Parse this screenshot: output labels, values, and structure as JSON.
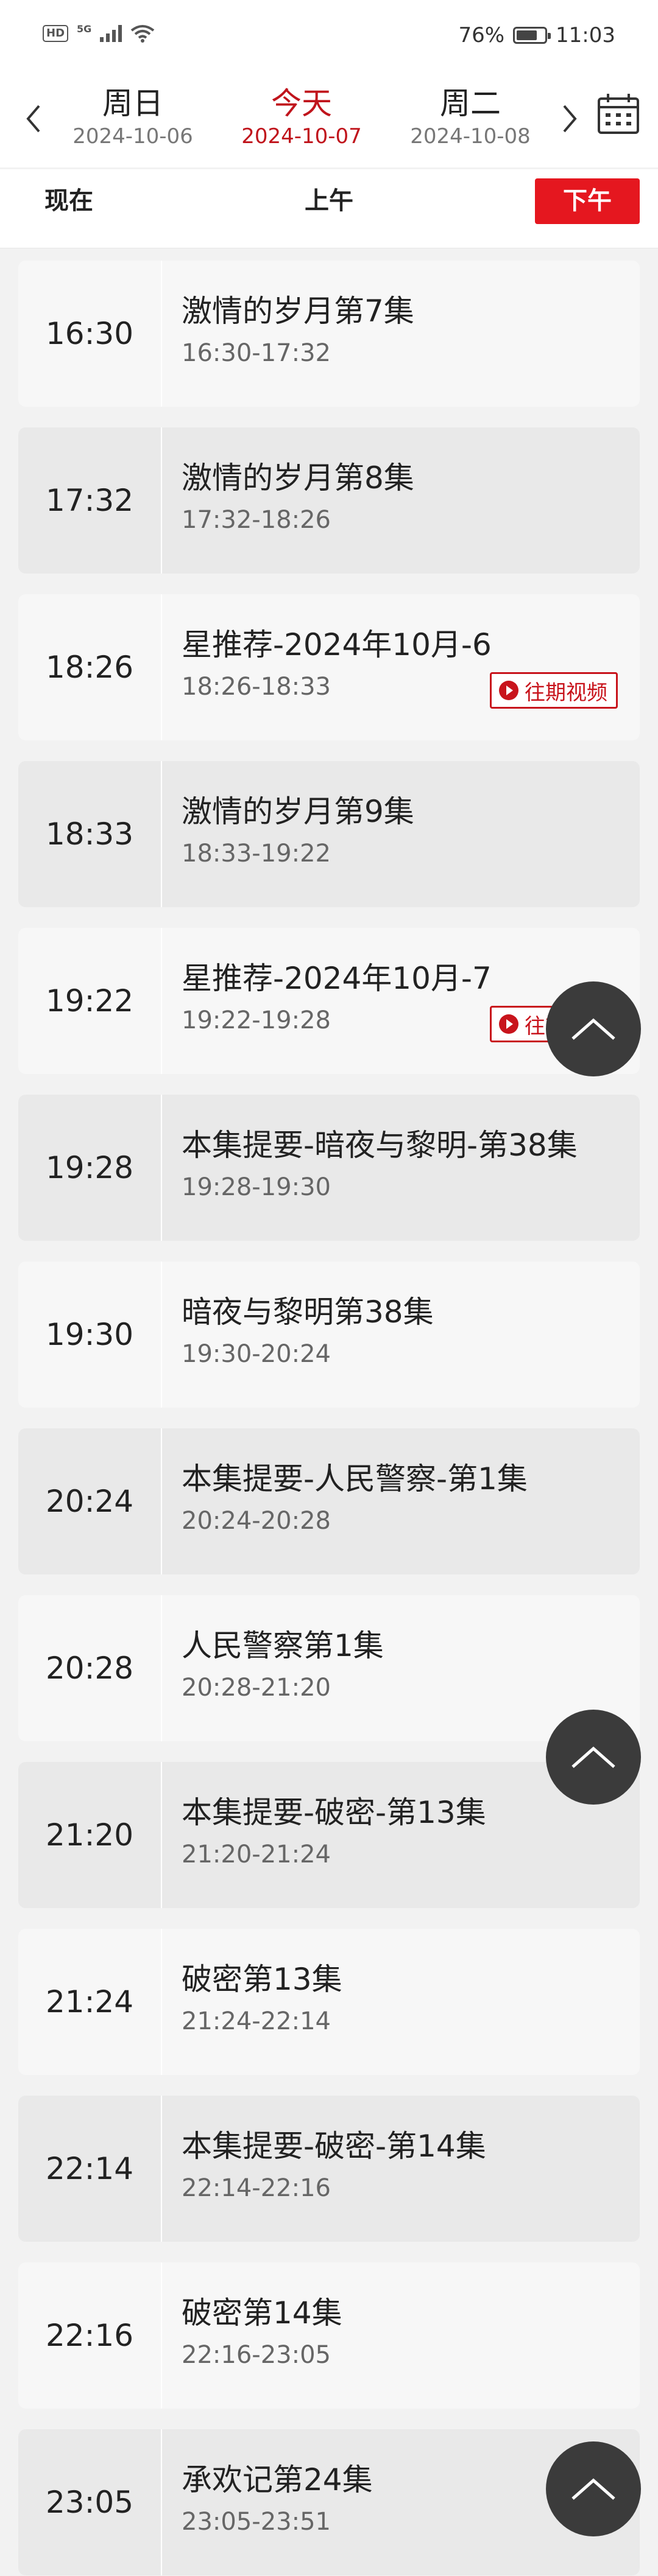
{
  "status_bar": {
    "hd": "HD",
    "network": "5G",
    "battery_percent_text": "76%",
    "battery_level": 0.76,
    "time": "11:03"
  },
  "date_nav": {
    "days": [
      {
        "name": "周日",
        "date": "2024-10-06",
        "active": false
      },
      {
        "name": "今天",
        "date": "2024-10-07",
        "active": true
      },
      {
        "name": "周二",
        "date": "2024-10-08",
        "active": false
      }
    ],
    "icons": {
      "prev": "chevron-left-icon",
      "next": "chevron-right-icon",
      "calendar": "calendar-icon"
    }
  },
  "period_tabs": {
    "now": "现在",
    "morning": "上午",
    "afternoon": "下午",
    "active": "afternoon"
  },
  "colors": {
    "accent": "#e5171f",
    "accent_text": "#c0141c"
  },
  "replay_label": "往期视频",
  "programs": [
    {
      "time": "16:30",
      "title": "激情的岁月第7集",
      "range": "16:30-17:32",
      "replay": false
    },
    {
      "time": "17:32",
      "title": "激情的岁月第8集",
      "range": "17:32-18:26",
      "replay": false
    },
    {
      "time": "18:26",
      "title": "星推荐-2024年10月-6",
      "range": "18:26-18:33",
      "replay": true
    },
    {
      "time": "18:33",
      "title": "激情的岁月第9集",
      "range": "18:33-19:22",
      "replay": false
    },
    {
      "time": "19:22",
      "title": "星推荐-2024年10月-7",
      "range": "19:22-19:28",
      "replay": true
    },
    {
      "time": "19:28",
      "title": "本集提要-暗夜与黎明-第38集",
      "range": "19:28-19:30",
      "replay": false
    },
    {
      "time": "19:30",
      "title": "暗夜与黎明第38集",
      "range": "19:30-20:24",
      "replay": false
    },
    {
      "time": "20:24",
      "title": "本集提要-人民警察-第1集",
      "range": "20:24-20:28",
      "replay": false
    },
    {
      "time": "20:28",
      "title": "人民警察第1集",
      "range": "20:28-21:20",
      "replay": false
    },
    {
      "time": "21:20",
      "title": "本集提要-破密-第13集",
      "range": "21:20-21:24",
      "replay": false
    },
    {
      "time": "21:24",
      "title": "破密第13集",
      "range": "21:24-22:14",
      "replay": false
    },
    {
      "time": "22:14",
      "title": "本集提要-破密-第14集",
      "range": "22:14-22:16",
      "replay": false
    },
    {
      "time": "22:16",
      "title": "破密第14集",
      "range": "22:16-23:05",
      "replay": false
    },
    {
      "time": "23:05",
      "title": "承欢记第24集",
      "range": "23:05-23:51",
      "replay": false
    }
  ],
  "scroll_top_icon": "chevron-up-icon"
}
